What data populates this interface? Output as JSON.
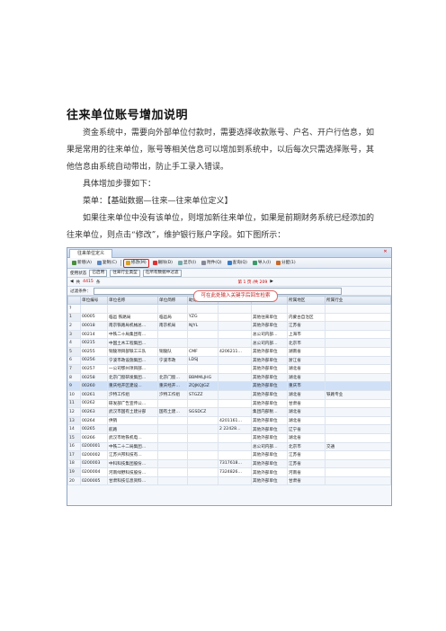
{
  "title": "往来单位账号增加说明",
  "paragraph1": "资金系统中，需要向外部单位付款时，需要选择收款账号、户名、开户行信息，如果是常用的往来单位，账号等相关信息可以增加到系统中，以后每次只需选择账号，其他信息由系统自动带出，防止手工录入错误。",
  "paragraph2": "具体增加步骤如下：",
  "paragraph3": "菜单：【基础数据—往来—往来单位定义】",
  "paragraph4": "如果往来单位中没有该单位，则增加新往来单位，如果是前期财务系统已经添加的往来单位，则点击“修改”，维护银行账户字段。如下图所示：",
  "screenshot": {
    "tab_label": "往来单位定义",
    "toolbar": [
      "新增(A)",
      "复制(C)",
      "修改(M)",
      "删除(D)",
      "显示(I)",
      "附件(Q)",
      "查询(Q)",
      "导入(I)",
      "分配(1)"
    ],
    "filter": {
      "label1": "使用状态",
      "value1": "已启用",
      "value2": "往来行业类型",
      "value3": "在所有数据中过滤"
    },
    "nav": {
      "prefix": "共",
      "count": "4415",
      "suffix": "条",
      "page_info": "第 1 页 /共 209"
    },
    "cond_label": "过滤条件：",
    "callout": "可在此处输入关键字后回车检索",
    "headers": [
      "",
      "单位编号",
      "单位名称",
      "单位简称",
      "助记码",
      "税号",
      "单位类别",
      "所属地区",
      "所属行业"
    ],
    "filter_row": [
      "?",
      "",
      "",
      "",
      "",
      "",
      "",
      "",
      ""
    ],
    "rows": [
      [
        "1",
        "00005",
        "临邑 铁路局",
        "临邑局",
        "YZG",
        "",
        "其他往来单位",
        "内蒙古自治区",
        ""
      ],
      [
        "2",
        "00018",
        "南京铁路局机械总…",
        "南京机局",
        "NJYL",
        "",
        "其他外部单位",
        "江苏省",
        ""
      ],
      [
        "3",
        "00214",
        "中铁二十局集团有…",
        "",
        "",
        "",
        "总公司内部…",
        "上海市",
        ""
      ],
      [
        "4",
        "00215",
        "中国土木工程集团…",
        "",
        "",
        "",
        "总公司内部…",
        "北京市",
        ""
      ],
      [
        "5",
        "00255",
        "铜陵项目部铁工三队",
        "铜陵队",
        "CMF",
        "4206211…",
        "其他外部单位",
        "湖南省",
        ""
      ],
      [
        "6",
        "00256",
        "宁波市政设施集团…",
        "宁波市政",
        "LDSJ",
        "",
        "其他外部单位",
        "浙江省",
        ""
      ],
      [
        "7",
        "00257",
        "一公司鄂州项目部…",
        "",
        "",
        "",
        "其他外部单位",
        "湖北省",
        ""
      ],
      [
        "8",
        "00258",
        "北京门窗研发集团…",
        "北京门窗…",
        "BBMMLJHG",
        "",
        "其他外部单位",
        "湖北省",
        ""
      ],
      [
        "9",
        "00260",
        "重庆经开区建设…",
        "重庆经开…",
        "ZQJKQJGZ",
        "",
        "其他外部单位",
        "重庆市",
        ""
      ],
      [
        "10",
        "00261",
        "汐特工作组",
        "汐特工作组",
        "STGZZ",
        "",
        "其他外部单位",
        "湖北省",
        "铁路专业"
      ],
      [
        "11",
        "00262",
        "研发部广告宣传公…",
        "",
        "",
        "",
        "其他外部单位",
        "甘肃省",
        ""
      ],
      [
        "12",
        "00263",
        "武汉市国有土建分部",
        "国有土建…",
        "SGSDCZ",
        "",
        "集团内部税…",
        "湖北省",
        ""
      ],
      [
        "13",
        "00264",
        "供销",
        "",
        "",
        "4201161…",
        "其他外部单位",
        "湖北省",
        ""
      ],
      [
        "14",
        "00265",
        "航路",
        "",
        "",
        "2 22428…",
        "其他外部单位",
        "辽宁省",
        ""
      ],
      [
        "15",
        "00266",
        "武汉市地铁机电…",
        "",
        "",
        "",
        "其他外部单位",
        "湖北省",
        ""
      ],
      [
        "16",
        "0200001",
        "中铁二十二局集团…",
        "",
        "",
        "",
        "总公司内部…",
        "北京市",
        "交通"
      ],
      [
        "17",
        "0200002",
        "江苏兴邦科技有…",
        "",
        "",
        "",
        "其他外部单位",
        "江苏省",
        ""
      ],
      [
        "18",
        "0200003",
        "中科科技集团股份…",
        "",
        "",
        "7317618…",
        "其他外部单位",
        "江苏省",
        ""
      ],
      [
        "19",
        "0200004",
        "河南绿野科技股份…",
        "",
        "",
        "7324826…",
        "其他外部单位",
        "河南省",
        ""
      ],
      [
        "20",
        "0200005",
        "甘肃科技信息资料…",
        "",
        "",
        "",
        "其他外部单位",
        "甘肃省",
        ""
      ]
    ]
  }
}
